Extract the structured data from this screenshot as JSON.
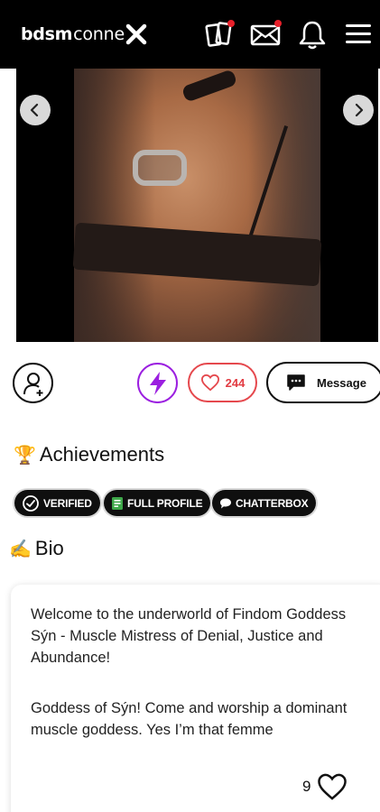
{
  "header": {
    "logo_bold": "bdsm",
    "logo_light": "conne",
    "colors": {
      "bg": "#000000",
      "notification_dot": "#e8202a"
    },
    "icons": [
      "cards-icon",
      "mail-icon",
      "bell-icon",
      "menu-icon"
    ]
  },
  "profile": {
    "like_count": "244",
    "message_label": "Message"
  },
  "achievements": {
    "emoji": "🏆",
    "title": "Achievements",
    "badges": [
      {
        "label": "VERIFIED",
        "icon": "check-circle-icon"
      },
      {
        "label": "FULL PROFILE",
        "icon": "profile-card-icon"
      },
      {
        "label": "CHATTERBOX",
        "icon": "speech-bubble-icon"
      }
    ]
  },
  "bio": {
    "emoji": "✍",
    "title": "Bio",
    "paragraphs": [
      "Welcome to the underworld of Findom Goddess Sýn - Muscle Mistress of Denial, Justice and Abundance!",
      "Goddess of Sýn! Come and worship a dominant muscle goddess. Yes I’m that femme"
    ],
    "like_count": "9"
  },
  "colors": {
    "accent_purple": "#9b1fe0",
    "like_red": "#e5484d"
  }
}
